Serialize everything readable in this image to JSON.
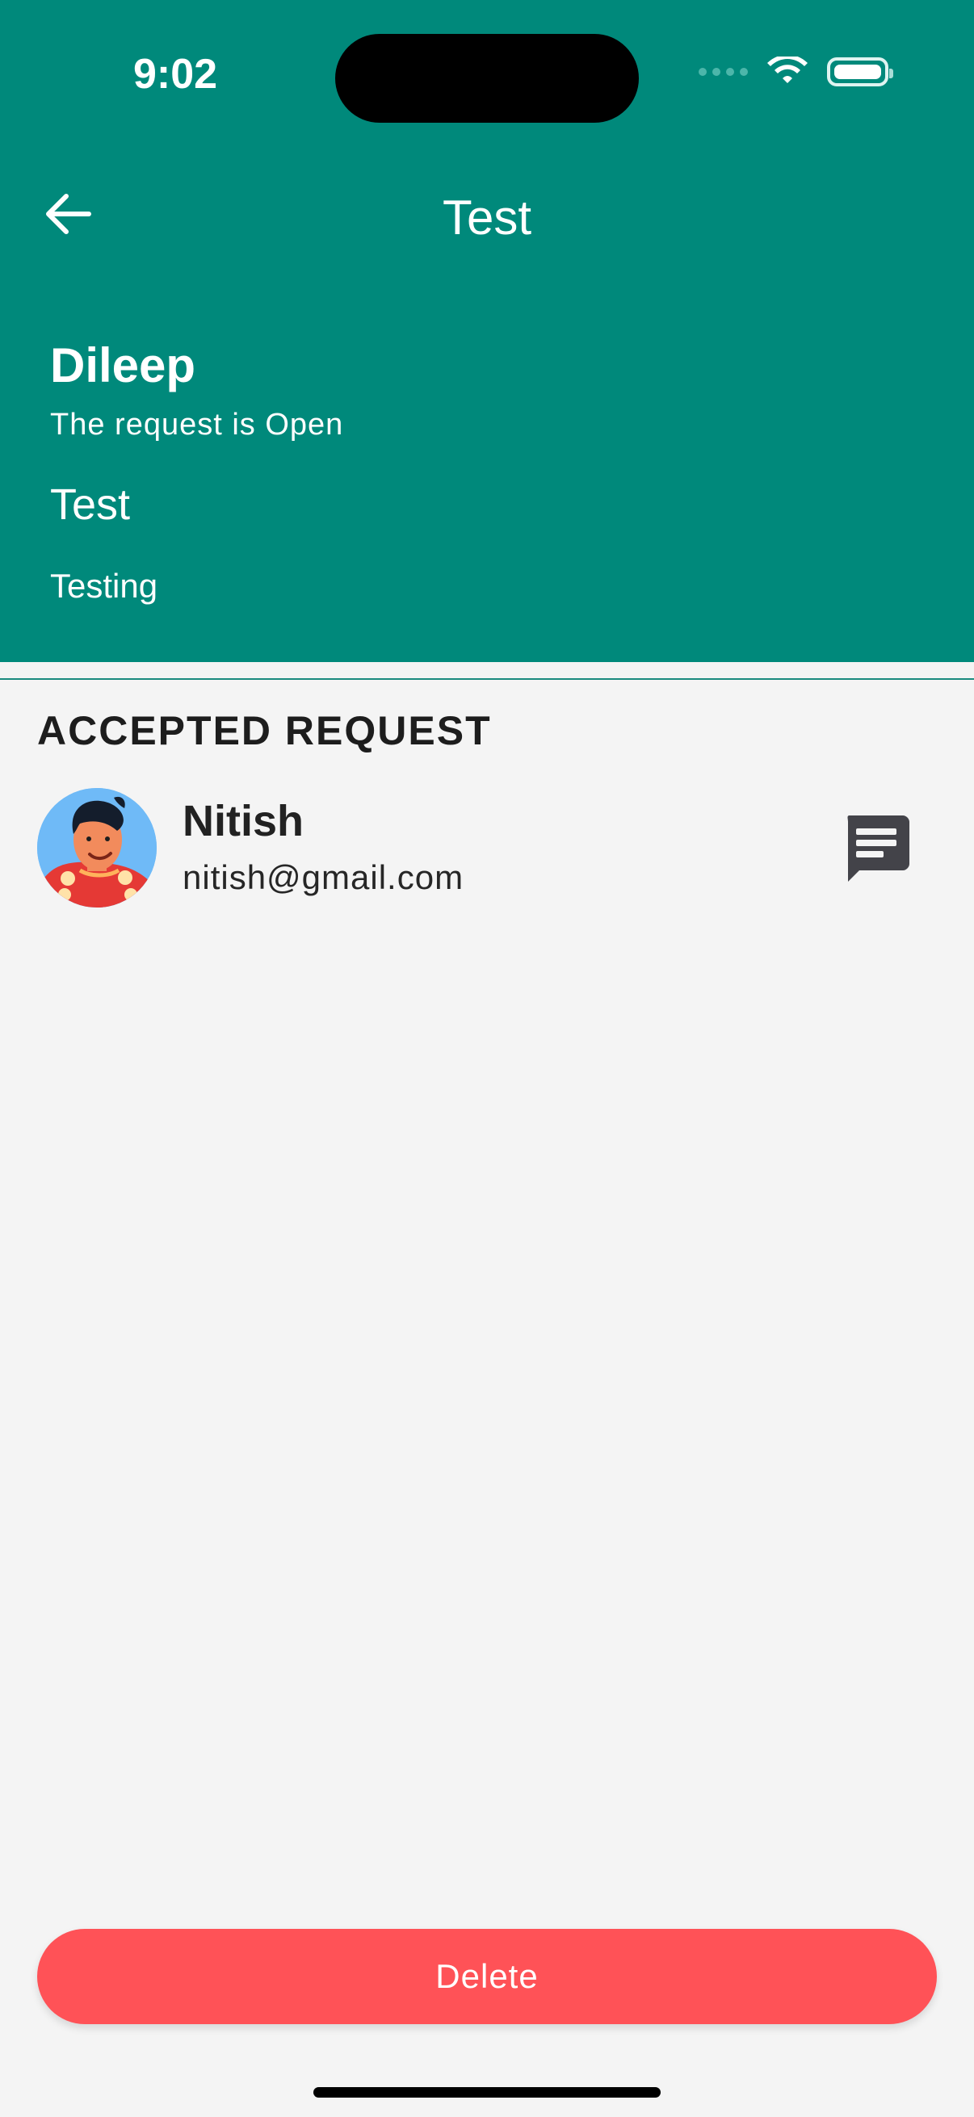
{
  "status_bar": {
    "time": "9:02"
  },
  "appbar": {
    "title": "Test",
    "back_icon": "arrow-left-icon"
  },
  "request": {
    "owner": "Dileep",
    "status_text": "The request is Open",
    "title": "Test",
    "description": "Testing"
  },
  "accepted_section": {
    "heading": "ACCEPTED REQUEST",
    "users": [
      {
        "name": "Nitish",
        "email": "nitish@gmail.com",
        "avatar_icon": "avatar",
        "chat_icon": "chat-icon"
      }
    ]
  },
  "actions": {
    "delete_label": "Delete"
  },
  "colors": {
    "header": "#00897b",
    "delete": "#ff5257",
    "background": "#f4f4f4"
  }
}
